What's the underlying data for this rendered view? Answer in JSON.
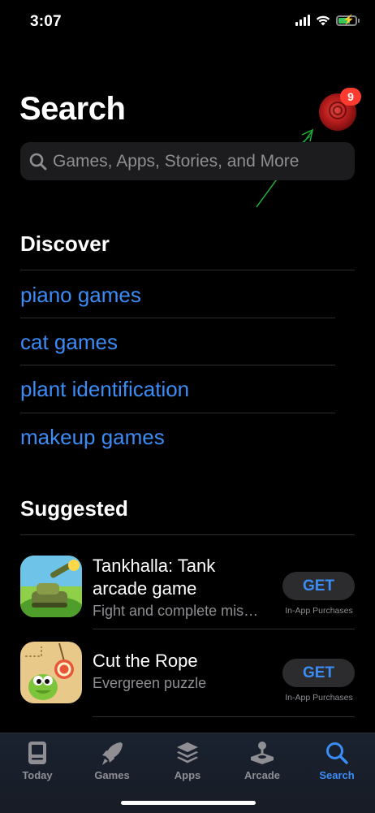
{
  "status": {
    "time": "3:07"
  },
  "header": {
    "title": "Search",
    "badge_count": "9"
  },
  "search": {
    "placeholder": "Games, Apps, Stories, and More"
  },
  "discover": {
    "title": "Discover",
    "items": [
      "piano games",
      "cat games",
      "plant identification",
      "makeup games"
    ]
  },
  "suggested": {
    "title": "Suggested",
    "apps": [
      {
        "name": "Tankhalla: Tank arcade game",
        "subtitle": "Fight and complete missions",
        "button": "GET",
        "note": "In-App Purchases"
      },
      {
        "name": "Cut the Rope",
        "subtitle": "Evergreen puzzle",
        "button": "GET",
        "note": "In-App Purchases"
      }
    ]
  },
  "tabs": [
    {
      "label": "Today",
      "icon": "today-icon"
    },
    {
      "label": "Games",
      "icon": "rocket-icon"
    },
    {
      "label": "Apps",
      "icon": "layers-icon"
    },
    {
      "label": "Arcade",
      "icon": "joystick-icon"
    },
    {
      "label": "Search",
      "icon": "search-icon",
      "active": true
    }
  ],
  "colors": {
    "accent": "#3b8cf5",
    "badge": "#ff3b30",
    "background": "#000000",
    "battery": "#34c759"
  }
}
